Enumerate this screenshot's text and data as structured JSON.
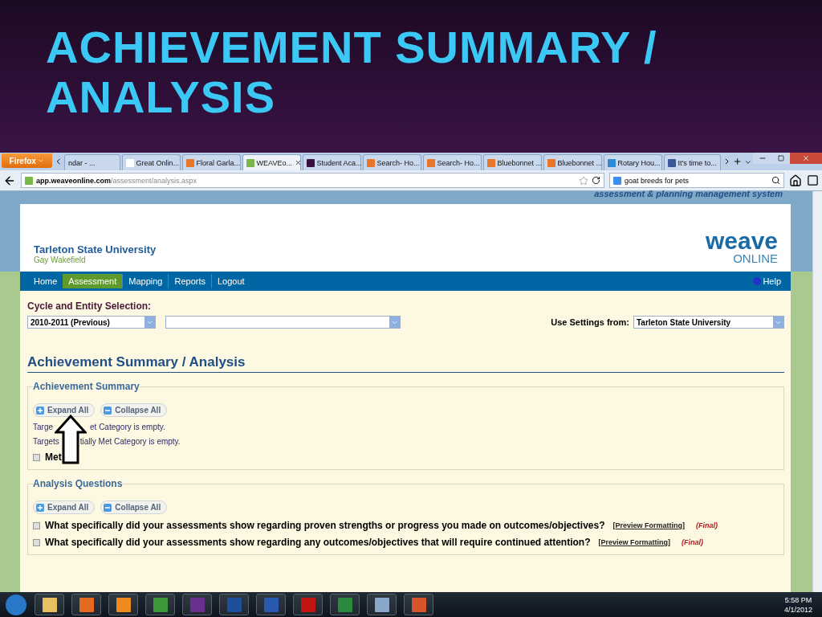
{
  "slide": {
    "title": "ACHIEVEMENT SUMMARY / ANALYSIS"
  },
  "browser": {
    "app_button": "Firefox",
    "tabs": [
      {
        "label": "ndar - ...",
        "selected": false
      },
      {
        "label": "Great Onlin...",
        "selected": false
      },
      {
        "label": "Floral Garla...",
        "selected": false
      },
      {
        "label": "WEAVEo...",
        "selected": true
      },
      {
        "label": "Student Aca...",
        "selected": false
      },
      {
        "label": "Search- Ho...",
        "selected": false
      },
      {
        "label": "Search- Ho...",
        "selected": false
      },
      {
        "label": "Bluebonnet ...",
        "selected": false
      },
      {
        "label": "Bluebonnet ...",
        "selected": false
      },
      {
        "label": "Rotary Hou...",
        "selected": false
      },
      {
        "label": "It's time to...",
        "selected": false
      }
    ],
    "url": {
      "domain": "app.weaveonline.com",
      "path": "/assessment/analysis.aspx"
    },
    "search": {
      "value": "goat breeds for pets"
    }
  },
  "page": {
    "tagline": "assessment & planning management system",
    "institution": "Tarleton State University",
    "user": "Gay Wakefield",
    "logo": {
      "word": "weave",
      "sub": "ONLINE"
    },
    "nav": [
      {
        "label": "Home",
        "selected": false
      },
      {
        "label": "Assessment",
        "selected": true
      },
      {
        "label": "Mapping",
        "selected": false
      },
      {
        "label": "Reports",
        "selected": false
      },
      {
        "label": "Logout",
        "selected": false
      }
    ],
    "help": "Help",
    "cycle_label": "Cycle and Entity Selection:",
    "cycle_value": "2010-2011  (Previous)",
    "settings_label": "Use Settings from:",
    "settings_value": "Tarleton State University",
    "heading": "Achievement Summary / Analysis",
    "sections": [
      {
        "title": "Achievement Summary",
        "buttons": [
          {
            "label": "Expand All",
            "kind": "expand"
          },
          {
            "label": "Collapse All",
            "kind": "collapse"
          }
        ],
        "lines": [
          {
            "kind": "note",
            "parts": [
              "Targe",
              "et Category is empty."
            ]
          },
          {
            "kind": "note",
            "parts": [
              "Targets",
              "tially Met Category is empty."
            ]
          },
          {
            "kind": "toggle",
            "parts": [
              "Met"
            ]
          }
        ]
      },
      {
        "title": "Analysis Questions",
        "buttons": [
          {
            "label": "Expand All",
            "kind": "expand"
          },
          {
            "label": "Collapse All",
            "kind": "collapse"
          }
        ],
        "lines": [
          {
            "kind": "question",
            "parts": [
              "What specifically did your assessments show regarding proven strengths or progress you made on outcomes/objectives?"
            ],
            "link": "[Preview Formatting]",
            "status": "(Final)"
          },
          {
            "kind": "question",
            "parts": [
              "What specifically did your assessments show regarding any outcomes/objectives that will require continued attention?"
            ],
            "link": "[Preview Formatting]",
            "status": "(Final)"
          }
        ]
      }
    ]
  },
  "taskbar": {
    "time": "5:58 PM",
    "date": "4/1/2012"
  }
}
